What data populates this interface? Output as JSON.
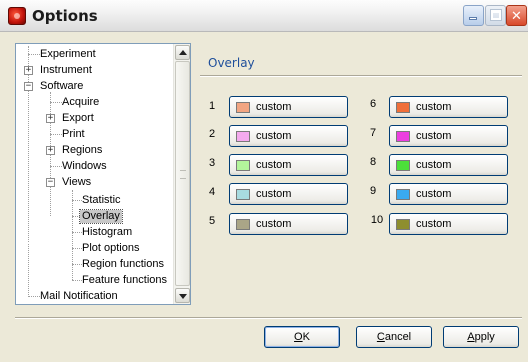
{
  "window": {
    "title": "Options",
    "icon": "app-icon",
    "controls": [
      "minimize-icon",
      "maximize-icon",
      "close-icon"
    ]
  },
  "tree": {
    "items": [
      {
        "label": "Experiment",
        "expander": ""
      },
      {
        "label": "Instrument",
        "expander": "+"
      },
      {
        "label": "Software",
        "expander": "−"
      },
      {
        "label": "Acquire",
        "expander": ""
      },
      {
        "label": "Export",
        "expander": "+"
      },
      {
        "label": "Print",
        "expander": ""
      },
      {
        "label": "Regions",
        "expander": "+"
      },
      {
        "label": "Windows",
        "expander": ""
      },
      {
        "label": "Views",
        "expander": "−"
      },
      {
        "label": "Statistic",
        "expander": ""
      },
      {
        "label": "Overlay",
        "expander": "",
        "selected": true
      },
      {
        "label": "Histogram",
        "expander": ""
      },
      {
        "label": "Plot options",
        "expander": ""
      },
      {
        "label": "Region functions",
        "expander": ""
      },
      {
        "label": "Feature functions",
        "expander": ""
      },
      {
        "label": "Mail Notification",
        "expander": ""
      }
    ]
  },
  "panel": {
    "title": "Overlay",
    "overlays": [
      {
        "number": "1",
        "label": "custom",
        "color": "#f2a582"
      },
      {
        "number": "2",
        "label": "custom",
        "color": "#f4aaee"
      },
      {
        "number": "3",
        "label": "custom",
        "color": "#b3f59b"
      },
      {
        "number": "4",
        "label": "custom",
        "color": "#a8dbe0"
      },
      {
        "number": "5",
        "label": "custom",
        "color": "#aaa587"
      },
      {
        "number": "6",
        "label": "custom",
        "color": "#f06f3a"
      },
      {
        "number": "7",
        "label": "custom",
        "color": "#ec3fe0"
      },
      {
        "number": "8",
        "label": "custom",
        "color": "#4cdf3a"
      },
      {
        "number": "9",
        "label": "custom",
        "color": "#3aaaf0"
      },
      {
        "number": "10",
        "label": "custom",
        "color": "#8e8e2e"
      }
    ]
  },
  "buttons": {
    "ok_first": "O",
    "ok_rest": "K",
    "cancel_first": "C",
    "cancel_rest": "ancel",
    "apply_first": "A",
    "apply_rest": "pply"
  }
}
